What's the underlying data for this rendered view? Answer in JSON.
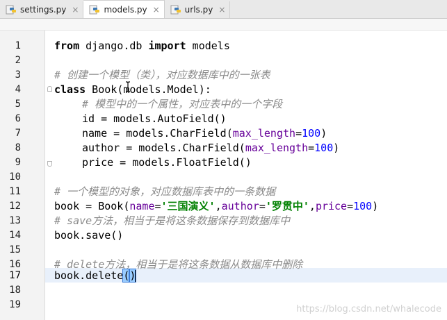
{
  "tabs": [
    {
      "label": "settings.py",
      "close": "×",
      "active": false
    },
    {
      "label": "models.py",
      "close": "×",
      "active": true
    },
    {
      "label": "urls.py",
      "close": "×",
      "active": false
    }
  ],
  "line_numbers": [
    "1",
    "2",
    "3",
    "4",
    "5",
    "6",
    "7",
    "8",
    "9",
    "10",
    "11",
    "12",
    "13",
    "14",
    "15",
    "16",
    "17",
    "18",
    "19"
  ],
  "current_line": 17,
  "code": {
    "l1_kw1": "from",
    "l1_mod": " django.db ",
    "l1_kw2": "import",
    "l1_rest": " models",
    "l3": "# 创建一个模型（类），对应数据库中的一张表",
    "l4_kw": "class",
    "l4_name": " Book",
    "l4_rest": "(models.Model):",
    "l5": "# 模型中的一个属性，对应表中的一个字段",
    "l6": "id = models.AutoField()",
    "l7_a": "name = models.CharField(",
    "l7_p": "max_length",
    "l7_eq": "=",
    "l7_n": "100",
    "l7_c": ")",
    "l8_a": "author = models.CharField(",
    "l8_p": "max_length",
    "l8_eq": "=",
    "l8_n": "100",
    "l8_c": ")",
    "l9": "price = models.FloatField()",
    "l11": "# 一个模型的对象，对应数据库表中的一条数据",
    "l12_a": "book = Book(",
    "l12_p1": "name",
    "l12_eq1": "=",
    "l12_s1": "'三国演义'",
    "l12_c1": ",",
    "l12_p2": "author",
    "l12_eq2": "=",
    "l12_s2": "'罗贯中'",
    "l12_c2": ",",
    "l12_p3": "price",
    "l12_eq3": "=",
    "l12_n": "100",
    "l12_end": ")",
    "l13": "# save方法，相当于是将这条数据保存到数据库中",
    "l14": "book.save()",
    "l16": "# delete方法，相当于是将这条数据从数据库中删除",
    "l17_a": "book.delete",
    "l17_po": "(",
    "l17_pc": ")"
  },
  "watermark": "https://blog.csdn.net/whalecode",
  "colors": {
    "keyword": "#000080",
    "comment": "#8a8a8a",
    "param": "#660099",
    "number": "#0000ff",
    "string": "#008000",
    "current_line": "#e8f0fb"
  }
}
